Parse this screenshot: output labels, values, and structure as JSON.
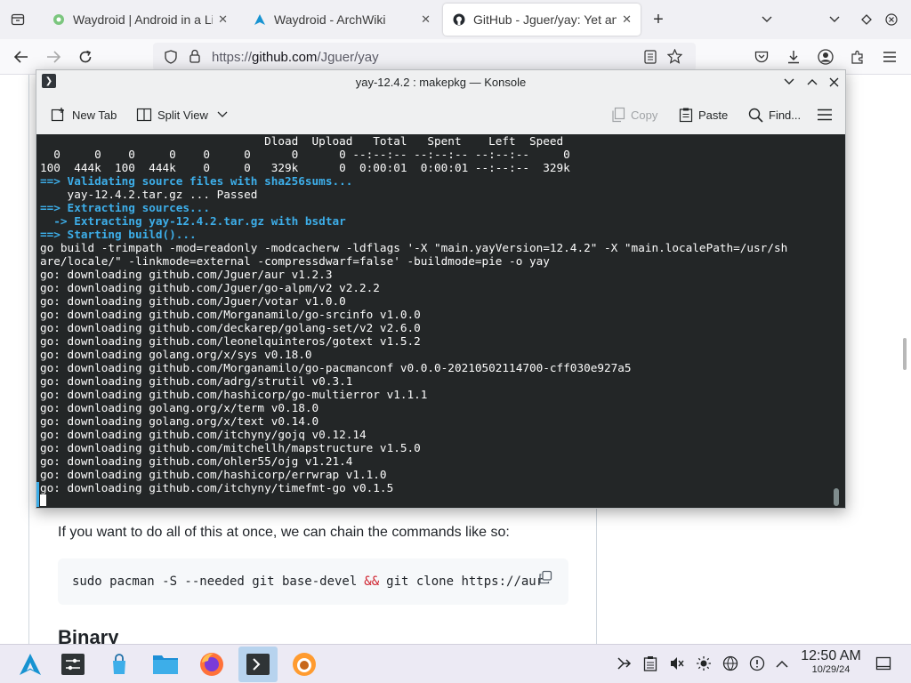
{
  "browser": {
    "tabs": [
      {
        "title": "Waydroid | Android in a Li",
        "active": false
      },
      {
        "title": "Waydroid - ArchWiki",
        "active": false
      },
      {
        "title": "GitHub - Jguer/yay: Yet ano",
        "active": true
      }
    ],
    "url": {
      "scheme": "https://",
      "host": "github.com",
      "path": "/Jguer/yay"
    }
  },
  "page": {
    "paragraph": "If you want to do all of this at once, we can chain the commands like so:",
    "code": {
      "part1": "sudo pacman -S --needed git base-devel",
      "amp": "&&",
      "part2": "git clone https://aur"
    },
    "heading": "Binary"
  },
  "konsole": {
    "title": "yay-12.4.2 : makepkg — Konsole",
    "toolbar": {
      "new_tab": "New Tab",
      "split_view": "Split View",
      "copy": "Copy",
      "paste": "Paste",
      "find": "Find..."
    },
    "lines": [
      {
        "text": "                                 Dload  Upload   Total   Spent    Left  Speed",
        "hl": false
      },
      {
        "text": "  0     0    0     0    0     0      0      0 --:--:-- --:--:-- --:--:--     0",
        "hl": false
      },
      {
        "text": "100  444k  100  444k    0     0   329k      0  0:00:01  0:00:01 --:--:--  329k",
        "hl": false
      },
      {
        "text": "==> Validating source files with sha256sums...",
        "hl": true
      },
      {
        "text": "    yay-12.4.2.tar.gz ... Passed",
        "hl": false
      },
      {
        "text": "==> Extracting sources...",
        "hl": true
      },
      {
        "text": "  -> Extracting yay-12.4.2.tar.gz with bsdtar",
        "hl": true
      },
      {
        "text": "==> Starting build()...",
        "hl": true
      },
      {
        "text": "go build -trimpath -mod=readonly -modcacherw -ldflags '-X \"main.yayVersion=12.4.2\" -X \"main.localePath=/usr/sh",
        "hl": false
      },
      {
        "text": "are/locale/\" -linkmode=external -compressdwarf=false' -buildmode=pie -o yay",
        "hl": false
      },
      {
        "text": "go: downloading github.com/Jguer/aur v1.2.3",
        "hl": false
      },
      {
        "text": "go: downloading github.com/Jguer/go-alpm/v2 v2.2.2",
        "hl": false
      },
      {
        "text": "go: downloading github.com/Jguer/votar v1.0.0",
        "hl": false
      },
      {
        "text": "go: downloading github.com/Morganamilo/go-srcinfo v1.0.0",
        "hl": false
      },
      {
        "text": "go: downloading github.com/deckarep/golang-set/v2 v2.6.0",
        "hl": false
      },
      {
        "text": "go: downloading github.com/leonelquinteros/gotext v1.5.2",
        "hl": false
      },
      {
        "text": "go: downloading golang.org/x/sys v0.18.0",
        "hl": false
      },
      {
        "text": "go: downloading github.com/Morganamilo/go-pacmanconf v0.0.0-20210502114700-cff030e927a5",
        "hl": false
      },
      {
        "text": "go: downloading github.com/adrg/strutil v0.3.1",
        "hl": false
      },
      {
        "text": "go: downloading github.com/hashicorp/go-multierror v1.1.1",
        "hl": false
      },
      {
        "text": "go: downloading golang.org/x/term v0.18.0",
        "hl": false
      },
      {
        "text": "go: downloading golang.org/x/text v0.14.0",
        "hl": false
      },
      {
        "text": "go: downloading github.com/itchyny/gojq v0.12.14",
        "hl": false
      },
      {
        "text": "go: downloading github.com/mitchellh/mapstructure v1.5.0",
        "hl": false
      },
      {
        "text": "go: downloading github.com/ohler55/ojg v1.21.4",
        "hl": false
      },
      {
        "text": "go: downloading github.com/hashicorp/errwrap v1.1.0",
        "hl": false
      },
      {
        "text": "go: downloading github.com/itchyny/timefmt-go v0.1.5",
        "hl": false
      }
    ]
  },
  "taskbar": {
    "time": "12:50 AM",
    "date": "10/29/24"
  },
  "colors": {
    "terminal_bg": "#232627",
    "terminal_fg": "#fcfcfc",
    "terminal_highlight": "#3daee9",
    "taskbar_active": "#b7d3ee"
  }
}
